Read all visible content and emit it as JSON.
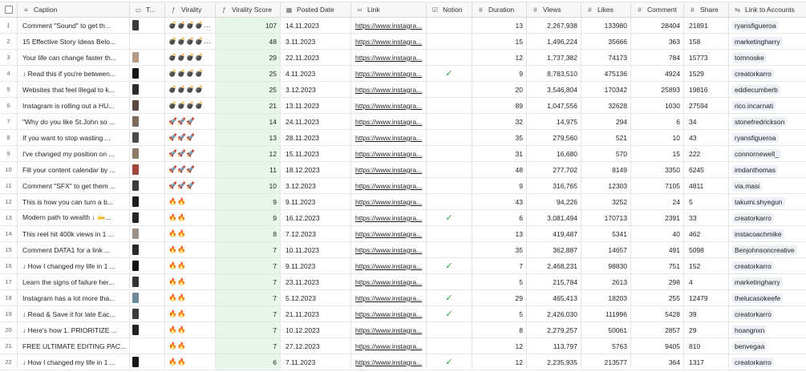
{
  "header": {
    "caption": "Caption",
    "thumb": "T...",
    "virality": "Virality",
    "virality_score": "Virality Score",
    "posted_date": "Posted Date",
    "link": "Link",
    "notion": "Notion",
    "duration": "Duration",
    "views": "Views",
    "likes": "Likes",
    "comment": "Comment",
    "share": "Share",
    "link_accounts": "Link to Accounts"
  },
  "icons": {
    "caption": "text-icon",
    "thumb": "attachment-icon",
    "virality": "formula-icon",
    "virality_score": "formula-icon",
    "posted_date": "calendar-icon",
    "link": "link-icon",
    "notion": "checkbox-icon",
    "duration": "number-icon",
    "views": "number-icon",
    "likes": "number-icon",
    "comment": "number-icon",
    "share": "number-icon",
    "link_accounts": "linked-record-icon"
  },
  "colors": {
    "virality_score_bg": "#e7f6e9",
    "check": "#2e9a47"
  },
  "rows": [
    {
      "n": "1",
      "caption": "Comment \"Sound\" to get th...",
      "virality": "💣💣💣💣...",
      "score": "107",
      "date": "14.11.2023",
      "link": "https://www.instagra...",
      "notion": "",
      "duration": "13",
      "views": "2,267,938",
      "likes": "133980",
      "comment": "28404",
      "share": "21891",
      "account": "ryansfigueroa",
      "thumb": "#3a3a3a"
    },
    {
      "n": "2",
      "caption": "15 Effective Story Ideas Belo...",
      "virality": "💣💣💣💣...",
      "score": "48",
      "date": "3.11.2023",
      "link": "https://www.instagra...",
      "notion": "",
      "duration": "15",
      "views": "1,496,224",
      "likes": "35666",
      "comment": "363",
      "share": "158",
      "account": "marketingharry",
      "thumb": ""
    },
    {
      "n": "3",
      "caption": "Your life can change faster th...",
      "virality": "💣💣💣💣",
      "score": "29",
      "date": "22.11.2023",
      "link": "https://www.instagra...",
      "notion": "",
      "duration": "12",
      "views": "1,737,382",
      "likes": "74173",
      "comment": "784",
      "share": "15773",
      "account": "tomnoske",
      "thumb": "#b59a86"
    },
    {
      "n": "4",
      "caption": "↓ Read this if you're between...",
      "virality": "💣💣💣💣",
      "score": "25",
      "date": "4.11.2023",
      "link": "https://www.instagra...",
      "notion": "✓",
      "duration": "9",
      "views": "8,783,510",
      "likes": "475136",
      "comment": "4924",
      "share": "1529",
      "account": "creatorkarro",
      "thumb": "#141414"
    },
    {
      "n": "5",
      "caption": "Websites that feel illegal to k...",
      "virality": "💣💣💣💣",
      "score": "25",
      "date": "3.12.2023",
      "link": "https://www.instagra...",
      "notion": "",
      "duration": "20",
      "views": "3,546,804",
      "likes": "170342",
      "comment": "25893",
      "share": "19816",
      "account": "eddiecumberb",
      "thumb": "#2b2b2b"
    },
    {
      "n": "6",
      "caption": "Instagram is rolling out a HU...",
      "virality": "💣💣💣💣",
      "score": "21",
      "date": "13.11.2023",
      "link": "https://www.instagra...",
      "notion": "",
      "duration": "89",
      "views": "1,047,556",
      "likes": "32628",
      "comment": "1030",
      "share": "27594",
      "account": "rico.incarnati",
      "thumb": "#5a4a42"
    },
    {
      "n": "7",
      "caption": "\"Why do you like St.John so ...",
      "virality": "🚀🚀🚀",
      "score": "14",
      "date": "24.11.2023",
      "link": "https://www.instagra...",
      "notion": "",
      "duration": "32",
      "views": "14,975",
      "likes": "294",
      "comment": "6",
      "share": "34",
      "account": "stonefredrickson",
      "thumb": "#7c6a5c"
    },
    {
      "n": "8",
      "caption": "If you want to stop wasting ...",
      "virality": "🚀🚀🚀",
      "score": "13",
      "date": "28.11.2023",
      "link": "https://www.instagra...",
      "notion": "",
      "duration": "35",
      "views": "279,560",
      "likes": "521",
      "comment": "10",
      "share": "43",
      "account": "ryansfigueroa",
      "thumb": "#4b4b4b"
    },
    {
      "n": "9",
      "caption": "I've changed my position on ...",
      "virality": "🚀🚀🚀",
      "score": "12",
      "date": "15.11.2023",
      "link": "https://www.instagra...",
      "notion": "",
      "duration": "31",
      "views": "16,680",
      "likes": "570",
      "comment": "15",
      "share": "222",
      "account": "connornewell_",
      "thumb": "#8a7a6a"
    },
    {
      "n": "10",
      "caption": "Fill your content calendar by ...",
      "virality": "🚀🚀🚀",
      "score": "11",
      "date": "18.12.2023",
      "link": "https://www.instagra...",
      "notion": "",
      "duration": "48",
      "views": "277,702",
      "likes": "8149",
      "comment": "3350",
      "share": "6245",
      "account": "imdanthomas",
      "thumb": "#a0463a"
    },
    {
      "n": "11",
      "caption": "Comment \"SFX\" to get them ...",
      "virality": "🚀🚀🚀",
      "score": "10",
      "date": "3.12.2023",
      "link": "https://www.instagra...",
      "notion": "",
      "duration": "9",
      "views": "316,765",
      "likes": "12303",
      "comment": "7105",
      "share": "4811",
      "account": "via.masi",
      "thumb": "#3b3b3b"
    },
    {
      "n": "12",
      "caption": "This is how you can turn a b...",
      "virality": "🔥🔥",
      "score": "9",
      "date": "9.11.2023",
      "link": "https://www.instagra...",
      "notion": "",
      "duration": "43",
      "views": "94,226",
      "likes": "3252",
      "comment": "24",
      "share": "5",
      "account": "takumi.shyegun",
      "thumb": "#1e1e1e"
    },
    {
      "n": "13",
      "caption": "Modern path to wealth ↓ 🫴...",
      "virality": "🔥🔥",
      "score": "9",
      "date": "16.12.2023",
      "link": "https://www.instagra...",
      "notion": "✓",
      "duration": "6",
      "views": "3,081,494",
      "likes": "170713",
      "comment": "2391",
      "share": "33",
      "account": "creatorkarro",
      "thumb": "#262626"
    },
    {
      "n": "14",
      "caption": "This reel hit 400k views in 1 ...",
      "virality": "🔥🔥",
      "score": "8",
      "date": "7.12.2023",
      "link": "https://www.instagra...",
      "notion": "",
      "duration": "13",
      "views": "419,487",
      "likes": "5341",
      "comment": "40",
      "share": "462",
      "account": "instacoachmike",
      "thumb": "#9b8f86"
    },
    {
      "n": "15",
      "caption": "Comment DATA1 for a link ...",
      "virality": "🔥🔥",
      "score": "7",
      "date": "10.11.2023",
      "link": "https://www.instagra...",
      "notion": "",
      "duration": "35",
      "views": "362,887",
      "likes": "14657",
      "comment": "491",
      "share": "5098",
      "account": "Benjohnsoncreative",
      "thumb": "#2a2a2a"
    },
    {
      "n": "16",
      "caption": "↓ How I changed my life in 1 ...",
      "virality": "🔥🔥",
      "score": "7",
      "date": "9.11.2023",
      "link": "https://www.instagra...",
      "notion": "✓",
      "duration": "7",
      "views": "2,468,231",
      "likes": "98830",
      "comment": "751",
      "share": "152",
      "account": "creatorkarro",
      "thumb": "#101010"
    },
    {
      "n": "17",
      "caption": "Learn the signs of failure her...",
      "virality": "🔥🔥",
      "score": "7",
      "date": "23.11.2023",
      "link": "https://www.instagra...",
      "notion": "",
      "duration": "5",
      "views": "215,784",
      "likes": "2613",
      "comment": "298",
      "share": "4",
      "account": "marketingharry",
      "thumb": "#333333"
    },
    {
      "n": "18",
      "caption": "Instagram has a lot more tha...",
      "virality": "🔥🔥",
      "score": "7",
      "date": "5.12.2023",
      "link": "https://www.instagra...",
      "notion": "✓",
      "duration": "29",
      "views": "465,413",
      "likes": "18203",
      "comment": "255",
      "share": "12479",
      "account": "thelucasokeefe",
      "thumb": "#6c8a9a"
    },
    {
      "n": "19",
      "caption": "↓ Read & Save it for late Eac...",
      "virality": "🔥🔥",
      "score": "7",
      "date": "21.11.2023",
      "link": "https://www.instagra...",
      "notion": "✓",
      "duration": "5",
      "views": "2,426,030",
      "likes": "111996",
      "comment": "5428",
      "share": "39",
      "account": "creatorkarro",
      "thumb": "#3a3a3a"
    },
    {
      "n": "20",
      "caption": "↓ Here's how 1. PRIORITIZE ...",
      "virality": "🔥🔥",
      "score": "7",
      "date": "10.12.2023",
      "link": "https://www.instagra...",
      "notion": "",
      "duration": "8",
      "views": "2,279,257",
      "likes": "50061",
      "comment": "2857",
      "share": "29",
      "account": "hoangnxn",
      "thumb": "#222222"
    },
    {
      "n": "21",
      "caption": "FREE ULTIMATE EDITING PAC...",
      "virality": "🔥🔥",
      "score": "7",
      "date": "27.12.2023",
      "link": "https://www.instagra...",
      "notion": "",
      "duration": "12",
      "views": "113,797",
      "likes": "5763",
      "comment": "9405",
      "share": "810",
      "account": "benvegaa",
      "thumb": ""
    },
    {
      "n": "22",
      "caption": "↓ How I changed my life in 1 ...",
      "virality": "🔥🔥",
      "score": "6",
      "date": "7.11.2023",
      "link": "https://www.instagra...",
      "notion": "✓",
      "duration": "12",
      "views": "2,235,935",
      "likes": "213577",
      "comment": "364",
      "share": "1317",
      "account": "creatorkarro",
      "thumb": "#181818"
    }
  ]
}
